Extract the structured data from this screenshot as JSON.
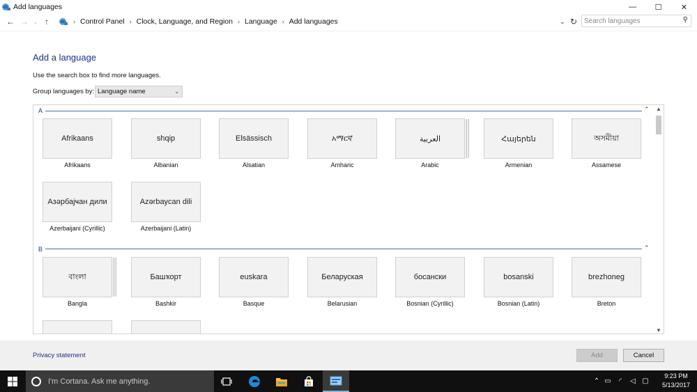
{
  "window": {
    "title": "Add languages",
    "minimize": "—",
    "maximize": "☐",
    "close": "✕"
  },
  "nav": {
    "back": "←",
    "forward": "→",
    "up": "↑",
    "breadcrumbs": [
      "Control Panel",
      "Clock, Language, and Region",
      "Language",
      "Add languages"
    ],
    "separator": "›",
    "dropdown": "⌄",
    "refresh": "↻",
    "search_placeholder": "Search languages"
  },
  "main": {
    "heading": "Add a language",
    "description": "Use the search box to find more languages.",
    "group_label": "Group languages by:",
    "group_value": "Language name"
  },
  "groups": [
    {
      "letter": "A",
      "collapse": "⌃",
      "languages": [
        {
          "native": "Afrikaans",
          "name": "Afrikaans",
          "stacked": false
        },
        {
          "native": "shqip",
          "name": "Albanian",
          "stacked": false
        },
        {
          "native": "Elsässisch",
          "name": "Alsatian",
          "stacked": false
        },
        {
          "native": "አማርኛ",
          "name": "Amharic",
          "stacked": false
        },
        {
          "native": "العربية",
          "name": "Arabic",
          "stacked": true
        },
        {
          "native": "Հայերեն",
          "name": "Armenian",
          "stacked": false
        },
        {
          "native": "অসমীয়া",
          "name": "Assamese",
          "stacked": false
        },
        {
          "native": "Азәрбајҹан дили",
          "name": "Azerbaijani (Cyrillic)",
          "stacked": false
        },
        {
          "native": "Azərbaycan dili",
          "name": "Azerbaijani (Latin)",
          "stacked": false
        }
      ]
    },
    {
      "letter": "B",
      "collapse": "⌃",
      "languages": [
        {
          "native": "বাংলা",
          "name": "Bangla",
          "stacked": true
        },
        {
          "native": "Башҡорт",
          "name": "Bashkir",
          "stacked": false
        },
        {
          "native": "euskara",
          "name": "Basque",
          "stacked": false
        },
        {
          "native": "Беларуская",
          "name": "Belarusian",
          "stacked": false
        },
        {
          "native": "босански",
          "name": "Bosnian (Cyrillic)",
          "stacked": false
        },
        {
          "native": "bosanski",
          "name": "Bosnian (Latin)",
          "stacked": false
        },
        {
          "native": "brezhoneg",
          "name": "Breton",
          "stacked": false
        }
      ]
    }
  ],
  "footer": {
    "privacy": "Privacy statement",
    "add": "Add",
    "cancel": "Cancel"
  },
  "taskbar": {
    "cortana_text": "I'm Cortana. Ask me anything.",
    "time": "9:23 PM",
    "date": "5/13/2017"
  },
  "colors": {
    "heading_blue": "#1e3287",
    "taskbar": "#101010",
    "tile_bg": "#f2f2f2"
  }
}
